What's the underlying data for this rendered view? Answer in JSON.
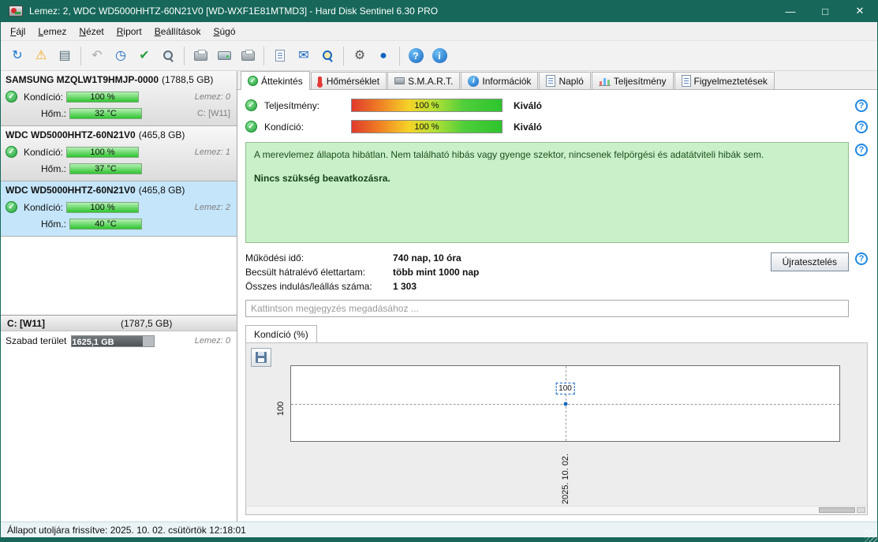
{
  "window": {
    "title": "Lemez: 2, WDC WD5000HHTZ-60N21V0 [WD-WXF1E81MTMD3]  -  Hard Disk Sentinel 6.30 PRO",
    "minimize_icon": "—",
    "maximize_icon": "□",
    "close_icon": "✕"
  },
  "menu": {
    "items": [
      "Fájl",
      "Lemez",
      "Nézet",
      "Riport",
      "Beállítások",
      "Súgó"
    ]
  },
  "icons": {
    "check": "✓",
    "check_heavy": "✔",
    "help": "?",
    "info": "i",
    "warning": "⚠",
    "refresh": "↻",
    "undo": "↶",
    "clock": "◷",
    "mail": "✉",
    "gear": "⚙",
    "surface": "▤",
    "globe": "●"
  },
  "toolbar": {
    "icon_names": [
      "refresh-icon",
      "refresh-warning-icon",
      "disk-surface-icon",
      "undo-icon",
      "disk-quick-test-icon",
      "disk-ok-icon",
      "disk-seek-icon",
      "printer-icon",
      "disk-tools-icon",
      "disk-print-icon",
      "report-icon",
      "email-icon",
      "find-disk-icon",
      "settings-gear-icon",
      "globe-icon",
      "help-icon",
      "info-icon"
    ]
  },
  "sidebar": {
    "disks": [
      {
        "name": "SAMSUNG MZQLW1T9HMJP-0000",
        "size": "(1788,5 GB)",
        "condition_label": "Kondíció:",
        "condition": "100 %",
        "temp_label": "Hőm.:",
        "temp": "32 °C",
        "index_label": "Lemez: 0",
        "drive_label": "C: [W11]"
      },
      {
        "name": "WDC WD5000HHTZ-60N21V0",
        "size": "(465,8 GB)",
        "condition_label": "Kondíció:",
        "condition": "100 %",
        "temp_label": "Hőm.:",
        "temp": "37 °C",
        "index_label": "Lemez: 1",
        "drive_label": ""
      },
      {
        "name": "WDC WD5000HHTZ-60N21V0",
        "size": "(465,8 GB)",
        "condition_label": "Kondíció:",
        "condition": "100 %",
        "temp_label": "Hőm.:",
        "temp": "40 °C",
        "index_label": "Lemez: 2",
        "drive_label": ""
      }
    ],
    "partition": {
      "name": "C: [W11]",
      "size": "(1787,5 GB)",
      "free_label": "Szabad terület",
      "free_value": "1625,1 GB",
      "index_label": "Lemez: 0"
    }
  },
  "tabs": {
    "items": [
      "Áttekintés",
      "Hőmérséklet",
      "S.M.A.R.T.",
      "Információk",
      "Napló",
      "Teljesítmény",
      "Figyelmeztetések"
    ],
    "active": "Áttekintés"
  },
  "overview": {
    "performance_label": "Teljesítmény:",
    "performance_value": "100 %",
    "performance_rating": "Kiváló",
    "condition_label": "Kondíció:",
    "condition_value": "100 %",
    "condition_rating": "Kiváló",
    "status_text": "A merevlemez állapota hibátlan. Nem található hibás vagy gyenge szektor, nincsenek felpörgési és adatátviteli hibák sem.",
    "status_bold": "Nincs szükség beavatkozásra.",
    "stats": [
      {
        "label": "Működési idő:",
        "value": "740 nap, 10 óra"
      },
      {
        "label": "Becsült hátralévő élettartam:",
        "value": "több mint 1000 nap"
      },
      {
        "label": "Összes indulás/leállás száma:",
        "value": "1 303"
      }
    ],
    "retest_button": "Újratesztelés",
    "comment_placeholder": "Kattintson megjegyzés megadásához ..."
  },
  "chart": {
    "tab_label": "Kondíció  (%)",
    "y_tick": "100",
    "x_tick": "2025. 10. 02.",
    "point_label": "100"
  },
  "chart_data": {
    "type": "line",
    "title": "Kondíció (%)",
    "x": [
      "2025. 10. 02."
    ],
    "series": [
      {
        "name": "Kondíció (%)",
        "values": [
          100
        ]
      }
    ],
    "y_ticks": [
      100
    ],
    "grid": "dashed"
  },
  "statusbar": {
    "text": "Állapot utoljára frissítve: 2025. 10. 02. csütörtök 12:18:01"
  },
  "colors": {
    "titlebar": "#17685a",
    "selected_disk": "#c5e5fa",
    "status_box_bg": "#c9f0c9",
    "bar_green": "#2fc42f",
    "accent_blue": "#1565c0"
  }
}
